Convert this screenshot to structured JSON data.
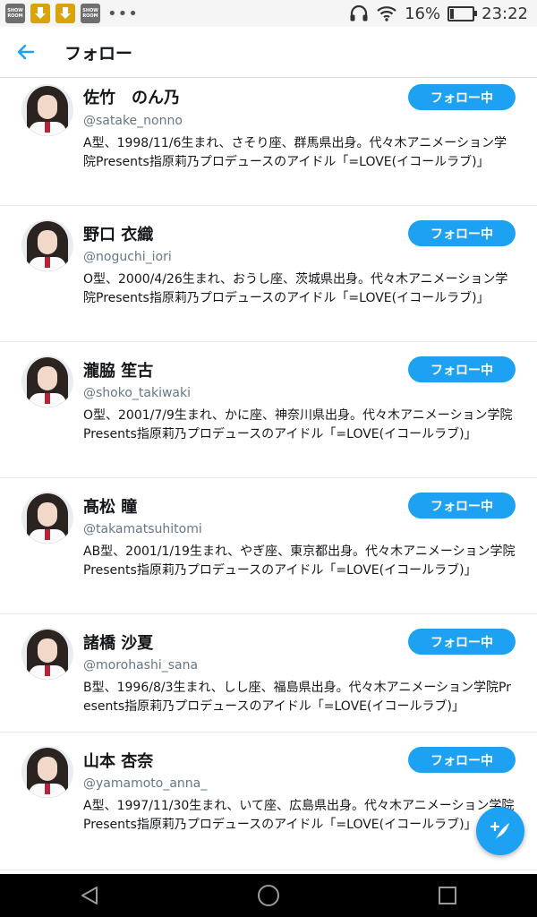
{
  "status_bar": {
    "notifications": [
      {
        "icon": "showroom-app-icon",
        "text": "SHOW ROOM"
      },
      {
        "icon": "download-icon"
      },
      {
        "icon": "download-icon"
      },
      {
        "icon": "showroom-app-icon",
        "text": "SHOW ROOM"
      }
    ],
    "more": "•••",
    "battery_percent": "16%",
    "battery_level": 0.16,
    "time": "23:22"
  },
  "header": {
    "back_icon": "back-arrow-icon",
    "title": "フォロー"
  },
  "accent_color": "#1da1f2",
  "users": [
    {
      "name": "佐竹　のん乃",
      "handle": "@satake_nonno",
      "bio": "A型、1998/11/6生まれ、さそり座、群馬県出身。代々木アニメーション学院Presents指原莉乃プロデュースのアイドル「=LOVE(イコールラブ)」",
      "button": "フォロー中"
    },
    {
      "name": "野口 衣織",
      "handle": "@noguchi_iori",
      "bio": "O型、2000/4/26生まれ、おうし座、茨城県出身。代々木アニメーション学院Presents指原莉乃プロデュースのアイドル「=LOVE(イコールラブ)」",
      "button": "フォロー中"
    },
    {
      "name": "瀧脇 笙古",
      "handle": "@shoko_takiwaki",
      "bio": "O型、2001/7/9生まれ、かに座、神奈川県出身。代々木アニメーション学院Presents指原莉乃プロデュースのアイドル「=LOVE(イコールラブ)」",
      "button": "フォロー中"
    },
    {
      "name": "髙松 瞳",
      "handle": "@takamatsuhitomi",
      "bio": "AB型、2001/1/19生まれ、やぎ座、東京都出身。代々木アニメーション学院Presents指原莉乃プロデュースのアイドル「=LOVE(イコールラブ)」",
      "button": "フォロー中"
    },
    {
      "name": "諸橋 沙夏",
      "handle": "@morohashi_sana",
      "bio": "B型、1996/8/3生まれ、しし座、福島県出身。代々木アニメーション学院Presents指原莉乃プロデュースのアイドル「=LOVE(イコールラブ)」",
      "button": "フォロー中"
    },
    {
      "name": "山本 杏奈",
      "handle": "@yamamoto_anna_",
      "bio": "A型、1997/11/30生まれ、いて座、広島県出身。代々木アニメーション学院Presents指原莉乃プロデュースのアイドル「=LOVE(イコールラブ)」",
      "button": "フォロー中"
    }
  ],
  "fab": {
    "icon": "compose-tweet-icon"
  },
  "nav_bar": {
    "back": "nav-back-icon",
    "home": "nav-home-icon",
    "recents": "nav-recents-icon"
  }
}
